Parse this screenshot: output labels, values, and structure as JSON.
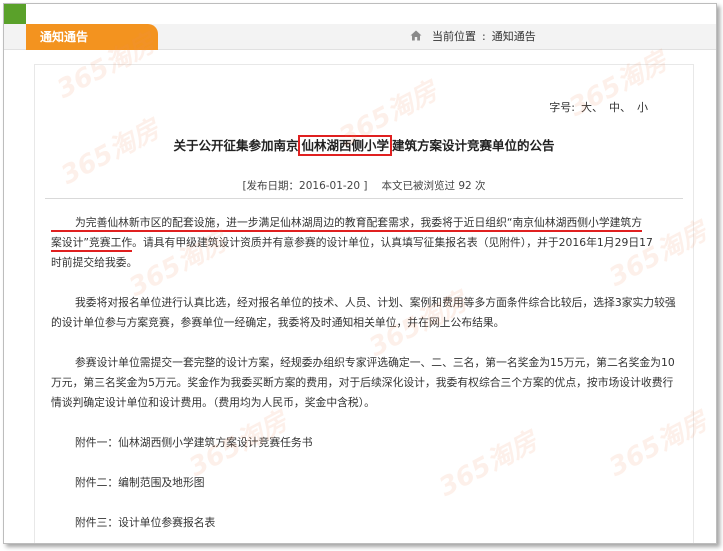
{
  "header": {
    "tab_label": "通知通告",
    "breadcrumb_label": "当前位置",
    "breadcrumb_sep": ":",
    "breadcrumb_current": "通知通告"
  },
  "fontsize": {
    "label": "字号:",
    "large": "大、",
    "medium": "中、",
    "small": "小"
  },
  "article": {
    "title_pre": "关于公开征集参加南京",
    "title_highlight": "仙林湖西侧小学",
    "title_post": "建筑方案设计竞赛单位的公告",
    "meta_date": "[发布日期：2016-01-20 ]",
    "meta_views": "本文已被浏览过 92 次",
    "p1_line1": "为完善仙林新市区的配套设施，进一步满足仙林湖周边的教育配套需求，我委将于近日组织“南京仙林湖西侧小学建筑方",
    "p1_line2_u": "案设计”竞赛工作",
    "p1_line2_rest": "。请具有甲级建筑设计资质并有意参赛的设计单位，认真填写征集报名表（见附件），并于2016年1月29日17",
    "p1_line3": "时前提交给我委。",
    "p2": "我委将对报名单位进行认真比选，经对报名单位的技术、人员、计划、案例和费用等多方面条件综合比较后，选择3家实力较强的设计单位参与方案竞赛，参赛单位一经确定，我委将及时通知相关单位，并在网上公布结果。",
    "p3": "参赛设计单位需提交一套完整的设计方案，经规委办组织专家评选确定一、二、三名，第一名奖金为15万元，第二名奖金为10万元，第三名奖金为5万元。奖金作为我委买断方案的费用，对于后续深化设计，我委有权综合三个方案的优点，按市场设计收费行情谈判确定设计单位和设计费用。（费用均为人民币，奖金中含税）。",
    "attachments": [
      "附件一：仙林湖西侧小学建筑方案设计竞赛任务书",
      "附件二：编制范围及地形图",
      "附件三：设计单位参赛报名表"
    ]
  },
  "watermark": "365淘房",
  "colors": {
    "tab_orange": "#f3931f",
    "strip_green": "#5aa12a",
    "annotation_red": "#e02020"
  }
}
